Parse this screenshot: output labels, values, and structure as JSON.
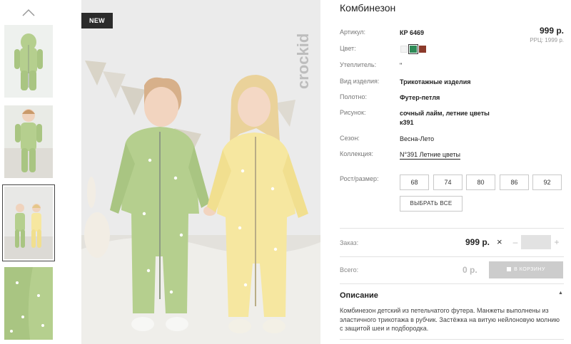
{
  "product": {
    "title": "Комбинезон",
    "badge": "NEW",
    "brand_mark": "crockid"
  },
  "attributes": {
    "article_label": "Артикул:",
    "article_value": "КР 6469",
    "color_label": "Цвет:",
    "insulation_label": "Утеплитель:",
    "insulation_value": "\"",
    "kind_label": "Вид изделия:",
    "kind_value": "Трикотажные изделия",
    "fabric_label": "Полотно:",
    "fabric_value": "Футер-петля",
    "pattern_label": "Рисунок:",
    "pattern_value_1": "сочный лайм, летние цветы",
    "pattern_value_2": "к391",
    "season_label": "Сезон:",
    "season_value": "Весна-Лето",
    "collection_label": "Коллекция:",
    "collection_value": "N°391 Летние цветы"
  },
  "price": {
    "main": "999 р.",
    "rrc": "РРЦ: 1999 р."
  },
  "colors": [
    {
      "name": "white",
      "hex": "#f4f4f4"
    },
    {
      "name": "green",
      "hex": "#2e8b57",
      "selected": true
    },
    {
      "name": "brown",
      "hex": "#8b3a2a"
    }
  ],
  "sizes": {
    "label": "Рост/размер:",
    "items": [
      "68",
      "74",
      "80",
      "86",
      "92"
    ],
    "select_all": "ВЫБРАТЬ ВСЕ"
  },
  "order": {
    "label": "Заказ:",
    "price": "999 р.",
    "times": "×",
    "minus": "–",
    "plus": "+",
    "qty": ""
  },
  "total": {
    "label": "Всего:",
    "value": "0 р.",
    "cart_button": "В КОРЗИНУ"
  },
  "description": {
    "title": "Описание",
    "arrow": "▲",
    "text": "Комбинезон детский из петельчатого футера. Манжеты выполнены из эластичного трикотажа в рубчик. Застёжка на витую нейлоновую молнию с защитой шеи и подбородка."
  },
  "palette": {
    "lime": "#b5cf8e",
    "yellow": "#f6e7a0",
    "backdrop": "#ebebeb"
  }
}
